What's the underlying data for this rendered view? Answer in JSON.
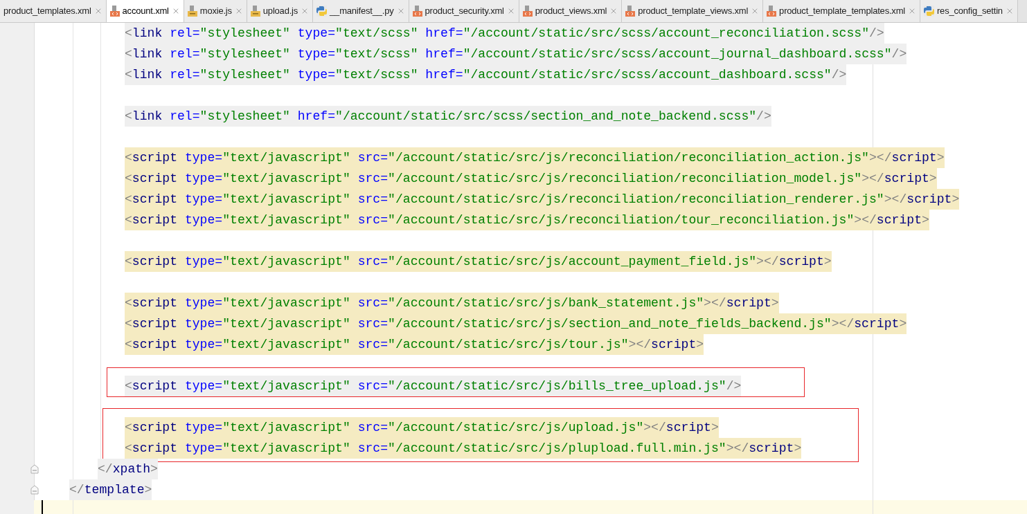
{
  "tabs": [
    {
      "label": "product_templates.xml",
      "kind": "none",
      "selected": false
    },
    {
      "label": "account.xml",
      "kind": "xml",
      "selected": true
    },
    {
      "label": "moxie.js",
      "kind": "js",
      "selected": false
    },
    {
      "label": "upload.js",
      "kind": "js",
      "selected": false
    },
    {
      "label": "__manifest__.py",
      "kind": "py",
      "selected": false
    },
    {
      "label": "product_security.xml",
      "kind": "xml",
      "selected": false
    },
    {
      "label": "product_views.xml",
      "kind": "xml",
      "selected": false
    },
    {
      "label": "product_template_views.xml",
      "kind": "xml",
      "selected": false
    },
    {
      "label": "product_template_templates.xml",
      "kind": "xml",
      "selected": false
    },
    {
      "label": "res_config_settin",
      "kind": "py",
      "selected": false
    }
  ],
  "groups": [
    {
      "boxed": false,
      "lines": [
        {
          "text": "<link rel=\"stylesheet\" type=\"text/scss\" href=\"/account/static/src/scss/account_reconciliation.scss\"/>",
          "color": "#efefef"
        },
        {
          "text": "<link rel=\"stylesheet\" type=\"text/scss\" href=\"/account/static/src/scss/account_journal_dashboard.scss\"/>",
          "color": "#efefef"
        },
        {
          "text": "<link rel=\"stylesheet\" type=\"text/scss\" href=\"/account/static/src/scss/account_dashboard.scss\"/>",
          "color": "#efefef"
        }
      ]
    },
    {
      "boxed": false,
      "lines": [
        {
          "text": "<link rel=\"stylesheet\" href=\"/account/static/src/scss/section_and_note_backend.scss\"/>",
          "color": "#efefef"
        }
      ]
    },
    {
      "boxed": false,
      "lines": [
        {
          "text": "<script type=\"text/javascript\" src=\"/account/static/src/js/reconciliation/reconciliation_action.js\"></script>",
          "color": "#f5ebc2"
        },
        {
          "text": "<script type=\"text/javascript\" src=\"/account/static/src/js/reconciliation/reconciliation_model.js\"></script>",
          "color": "#f5ebc2"
        },
        {
          "text": "<script type=\"text/javascript\" src=\"/account/static/src/js/reconciliation/reconciliation_renderer.js\"></script>",
          "color": "#f5ebc2"
        },
        {
          "text": "<script type=\"text/javascript\" src=\"/account/static/src/js/reconciliation/tour_reconciliation.js\"></script>",
          "color": "#f5ebc2"
        }
      ]
    },
    {
      "boxed": false,
      "lines": [
        {
          "text": "<script type=\"text/javascript\" src=\"/account/static/src/js/account_payment_field.js\"></script>",
          "color": "#f5ebc2"
        }
      ]
    },
    {
      "boxed": false,
      "lines": [
        {
          "text": "<script type=\"text/javascript\" src=\"/account/static/src/js/bank_statement.js\"></script>",
          "color": "#f5ebc2"
        },
        {
          "text": "<script type=\"text/javascript\" src=\"/account/static/src/js/section_and_note_fields_backend.js\"></script>",
          "color": "#f5ebc2"
        },
        {
          "text": "<script type=\"text/javascript\" src=\"/account/static/src/js/tour.js\"></script>",
          "color": "#f5ebc2"
        }
      ]
    },
    {
      "boxed": true,
      "lines": [
        {
          "text": "<script type=\"text/javascript\" src=\"/account/static/src/js/bills_tree_upload.js\"/>",
          "color": "#efefef"
        }
      ]
    },
    {
      "boxed": true,
      "lines": [
        {
          "text": "<script type=\"text/javascript\" src=\"/account/static/src/js/upload.js\"></script>",
          "color": "#f5ebc2"
        },
        {
          "text": "<script type=\"text/javascript\" src=\"/account/static/src/js/plupload.full.min.js\"></script>",
          "color": "#f5ebc2"
        }
      ]
    }
  ],
  "closing": [
    {
      "text": "</xpath>",
      "kind": "xpath"
    },
    {
      "text": "</template>",
      "kind": "template"
    }
  ]
}
